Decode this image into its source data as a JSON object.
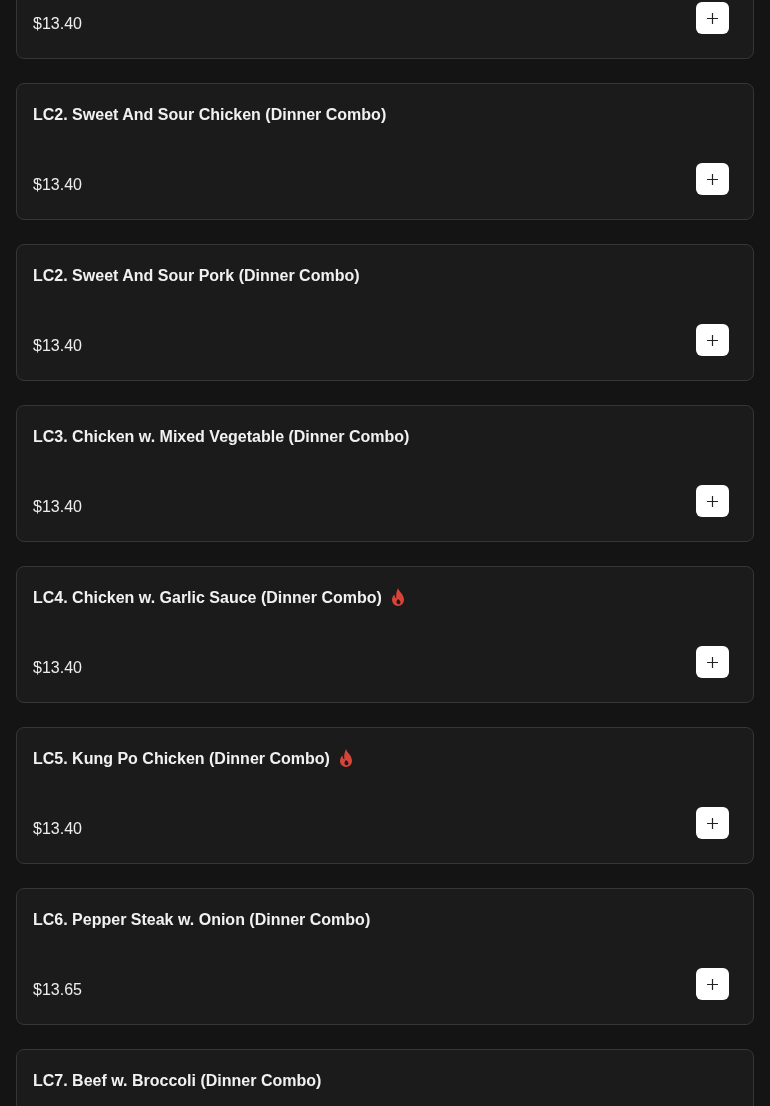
{
  "items": [
    {
      "price": "$13.40",
      "spicy": false
    },
    {
      "name": "LC2. Sweet And Sour Chicken (Dinner Combo)",
      "price": "$13.40",
      "spicy": false
    },
    {
      "name": "LC2. Sweet And Sour Pork (Dinner Combo)",
      "price": "$13.40",
      "spicy": false
    },
    {
      "name": "LC3. Chicken w. Mixed Vegetable (Dinner Combo)",
      "price": "$13.40",
      "spicy": false
    },
    {
      "name": "LC4. Chicken w. Garlic Sauce (Dinner Combo)",
      "price": "$13.40",
      "spicy": true
    },
    {
      "name": "LC5. Kung Po Chicken (Dinner Combo)",
      "price": "$13.40",
      "spicy": true
    },
    {
      "name": "LC6. Pepper Steak w. Onion (Dinner Combo)",
      "price": "$13.65",
      "spicy": false
    },
    {
      "name": "LC7. Beef w. Broccoli (Dinner Combo)",
      "spicy": false
    }
  ]
}
